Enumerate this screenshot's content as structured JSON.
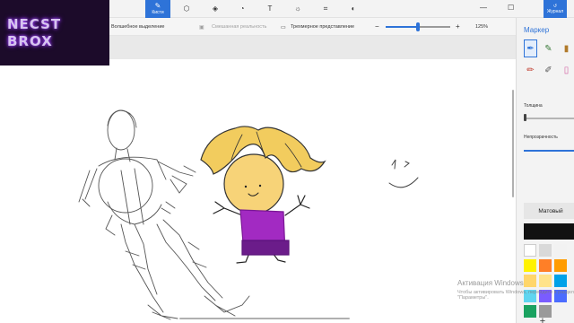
{
  "toolbar": {
    "tools": [
      {
        "name": "brushes",
        "label": "Кисти",
        "icon": "brush-icon",
        "active": true
      },
      {
        "name": "shapes-2d",
        "label": "",
        "icon": "2d-shapes-icon"
      },
      {
        "name": "shapes-3d",
        "label": "",
        "icon": "3d-shapes-icon"
      },
      {
        "name": "stickers",
        "label": "",
        "icon": "stickers-icon"
      },
      {
        "name": "text",
        "label": "",
        "icon": "text-icon"
      },
      {
        "name": "effects",
        "label": "",
        "icon": "effects-icon"
      },
      {
        "name": "canvas",
        "label": "",
        "icon": "canvas-icon"
      },
      {
        "name": "3d-library",
        "label": "",
        "icon": "3d-library-icon"
      }
    ],
    "journal_label": "Журнал"
  },
  "subbar": {
    "magic_select": "Волшебное выделение",
    "mixed_reality": "Смешанная реальность",
    "view_3d": "Трехмерное представление",
    "zoom_value": "125%",
    "zoom_fraction": 0.5
  },
  "logo": {
    "line1": "NECST",
    "line2": "BROX"
  },
  "panel": {
    "title": "Маркер",
    "thickness_label": "Толщина",
    "opacity_label": "Непрозрачность",
    "finish_label": "Матовый",
    "current_color": "#111111",
    "palette": [
      "#ffffff",
      "#d9d9d9",
      "#f2f2f2",
      "#fff200",
      "#ff7f27",
      "#ff9c00",
      "#ffd66a",
      "#ffe38a",
      "#00a2e8",
      "#5fd5f0",
      "#7a5cff",
      "#4b6cff",
      "#1aa260",
      "#9a9a9a"
    ]
  },
  "watermark": {
    "title": "Активация Windows",
    "line2": "Чтобы активировать Windows, перейдите в раздел",
    "line3": "\"Параметры\"."
  }
}
